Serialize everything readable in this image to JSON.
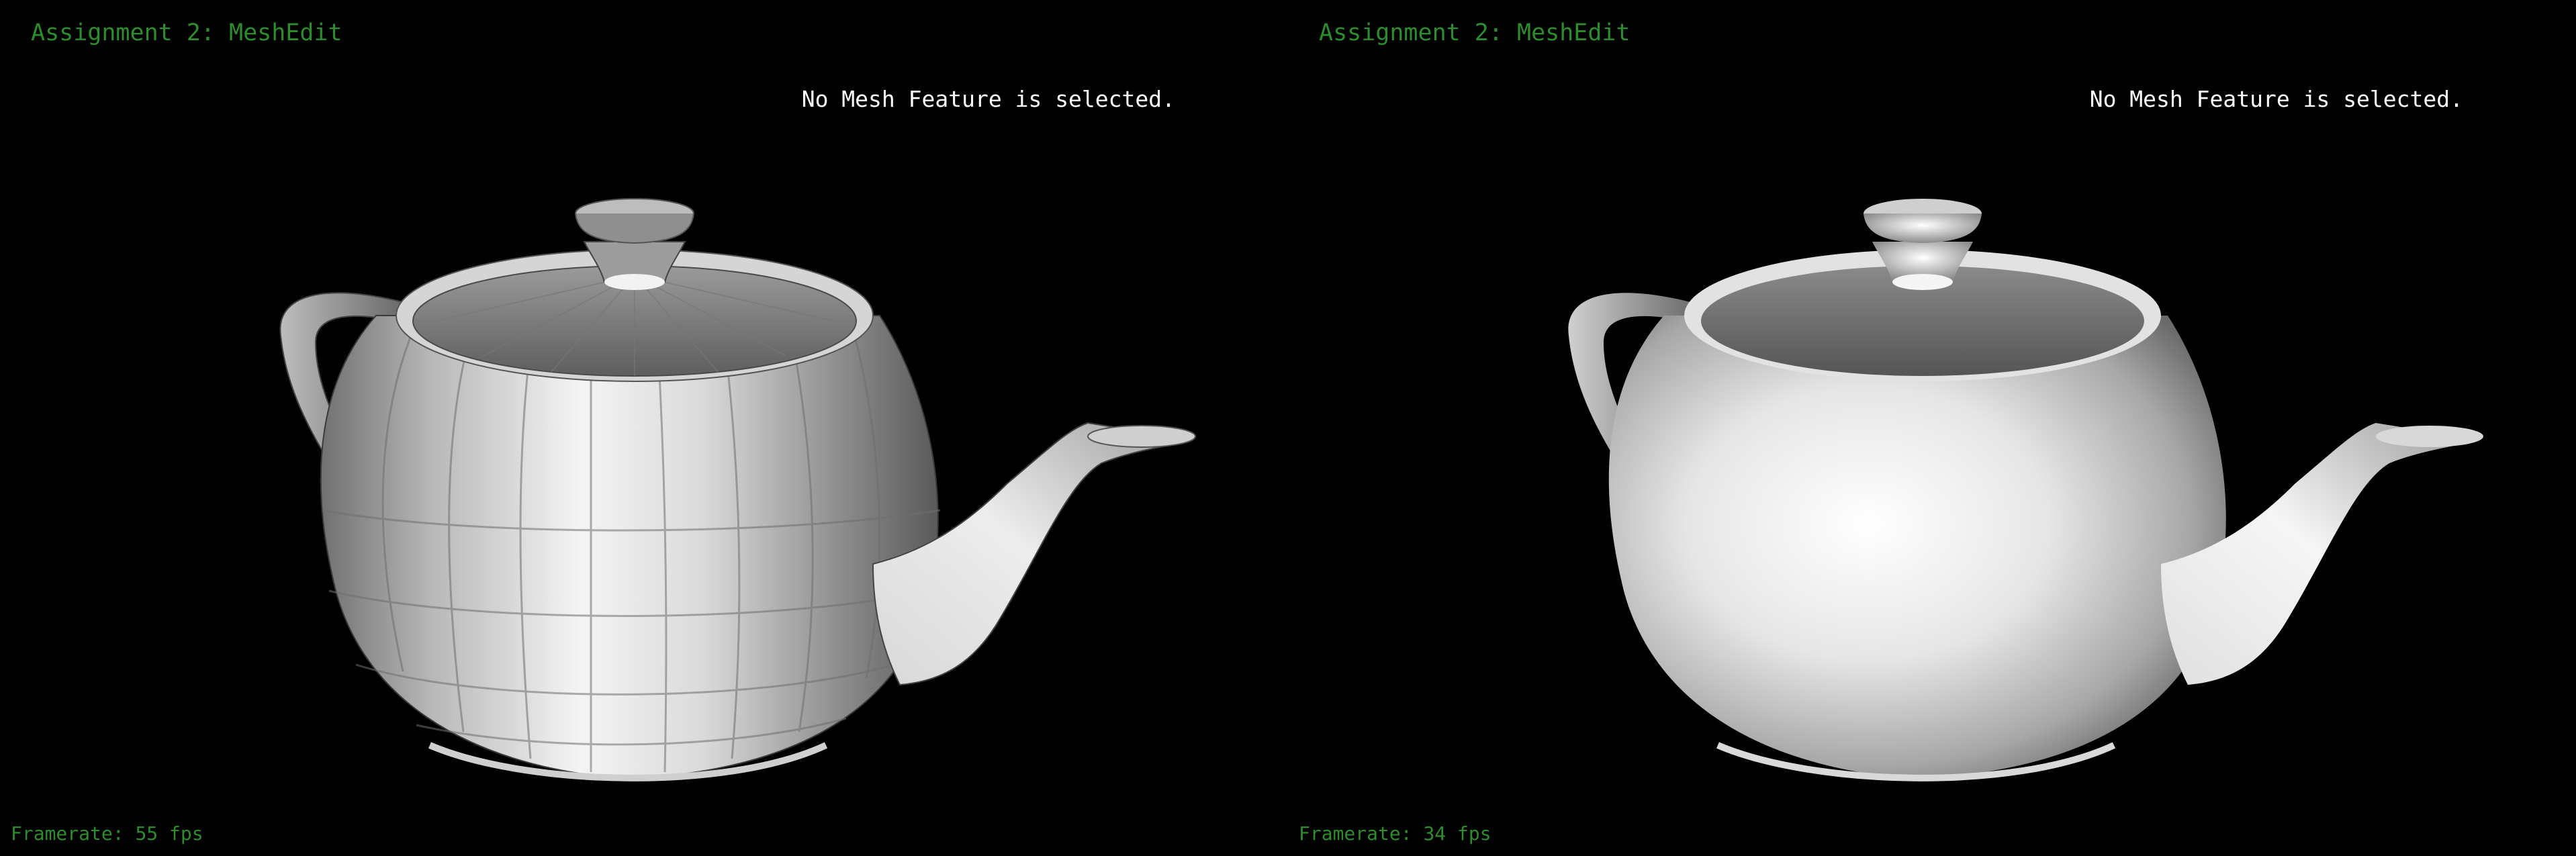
{
  "app": {
    "title": "Assignment 2: MeshEdit"
  },
  "viewports": [
    {
      "title": "Assignment 2: MeshEdit",
      "status": "No Mesh Feature is selected.",
      "framerate_label": "Framerate:",
      "framerate_value": "55 fps",
      "shading": "flat",
      "model": "teapot"
    },
    {
      "title": "Assignment 2: MeshEdit",
      "status": "No Mesh Feature is selected.",
      "framerate_label": "Framerate:",
      "framerate_value": "34 fps",
      "shading": "smooth",
      "model": "teapot"
    }
  ],
  "colors": {
    "background": "#000000",
    "title_text": "#2e8b2e",
    "status_text": "#ffffff",
    "mesh_light": "#f5f5f5",
    "mesh_dark": "#5a5a5a"
  }
}
